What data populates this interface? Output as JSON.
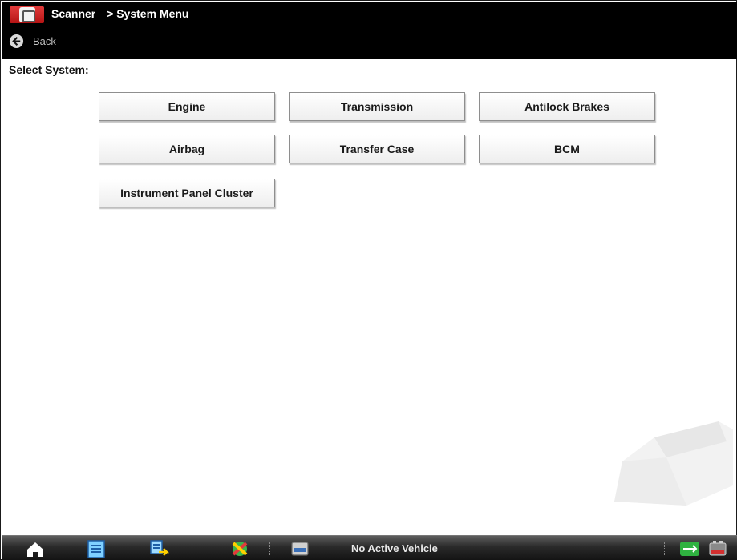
{
  "header": {
    "breadcrumb": [
      "Scanner",
      "> System Menu"
    ],
    "back_label": "Back"
  },
  "main": {
    "select_label": "Select System:",
    "systems": [
      "Engine",
      "Transmission",
      "Antilock Brakes",
      "Airbag",
      "Transfer Case",
      "BCM",
      "Instrument Panel Cluster"
    ]
  },
  "taskbar": {
    "status_text": "No Active Vehicle",
    "icons": [
      "home-icon",
      "scanner-list-icon",
      "data-transfer-icon",
      "tools-icon",
      "vehicle-id-icon",
      "connection-status-icon",
      "battery-icon"
    ]
  },
  "colors": {
    "header_bg": "#000000",
    "app_icon_red": "#c8191e",
    "taskbar_bg": "#2a2a2a"
  }
}
